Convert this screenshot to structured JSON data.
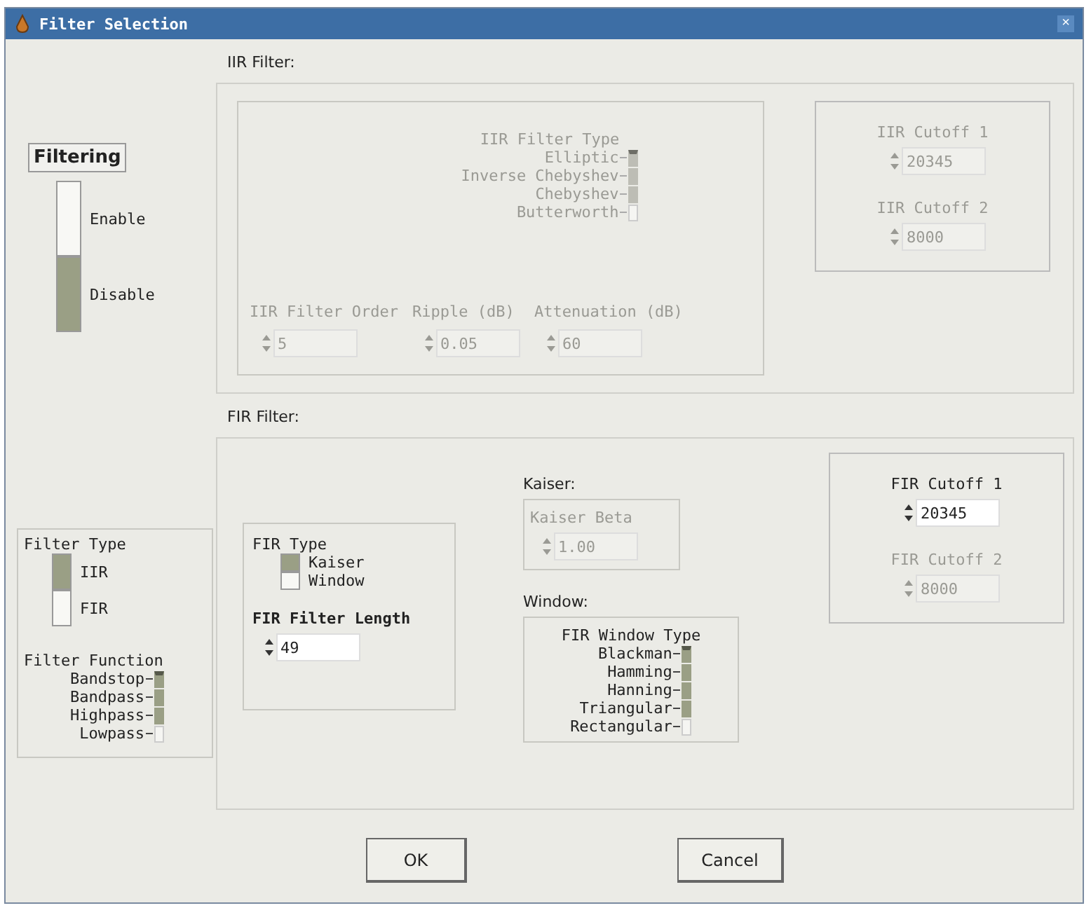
{
  "window": {
    "title": "Filter Selection",
    "close": "×"
  },
  "filtering": {
    "label": "Filtering",
    "options": [
      {
        "label": "Enable",
        "selected": false
      },
      {
        "label": "Disable",
        "selected": true
      }
    ]
  },
  "iir": {
    "heading": "IIR Filter:",
    "disabled": true,
    "type": {
      "label": "IIR Filter Type",
      "options": [
        {
          "label": "Elliptic",
          "selected": true
        },
        {
          "label": "Inverse Chebyshev",
          "selected": false
        },
        {
          "label": "Chebyshev",
          "selected": false
        },
        {
          "label": "Butterworth",
          "selected": false
        }
      ]
    },
    "params": [
      {
        "label": "IIR Filter Order",
        "value": "5"
      },
      {
        "label": "Ripple (dB)",
        "value": "0.05"
      },
      {
        "label": "Attenuation (dB)",
        "value": "60"
      }
    ],
    "cutoffs": [
      {
        "label": "IIR Cutoff 1",
        "value": "20345",
        "disabled": true
      },
      {
        "label": "IIR Cutoff 2",
        "value": "8000",
        "disabled": true
      }
    ]
  },
  "filter_type": {
    "label": "Filter Type",
    "options": [
      {
        "label": "IIR",
        "selected": true
      },
      {
        "label": "FIR",
        "selected": false
      }
    ]
  },
  "filter_function": {
    "label": "Filter Function",
    "options": [
      {
        "label": "Bandstop",
        "selected": true
      },
      {
        "label": "Bandpass",
        "selected": false
      },
      {
        "label": "Highpass",
        "selected": false
      },
      {
        "label": "Lowpass",
        "selected": false
      }
    ]
  },
  "fir": {
    "heading": "FIR Filter:",
    "type": {
      "label": "FIR Type",
      "options": [
        {
          "label": "Kaiser",
          "selected": true
        },
        {
          "label": "Window",
          "selected": false
        }
      ]
    },
    "length": {
      "label": "FIR Filter Length",
      "value": "49"
    },
    "kaiser": {
      "heading": "Kaiser:",
      "label": "Kaiser Beta",
      "value": "1.00",
      "disabled": true
    },
    "window": {
      "heading": "Window:",
      "label": "FIR Window Type",
      "options": [
        {
          "label": "Blackman",
          "selected": true
        },
        {
          "label": "Hamming",
          "selected": false
        },
        {
          "label": "Hanning",
          "selected": false
        },
        {
          "label": "Triangular",
          "selected": false
        },
        {
          "label": "Rectangular",
          "selected": false
        }
      ]
    },
    "cutoffs": [
      {
        "label": "FIR Cutoff 1",
        "value": "20345",
        "disabled": false
      },
      {
        "label": "FIR Cutoff 2",
        "value": "8000",
        "disabled": true
      }
    ]
  },
  "buttons": [
    "OK",
    "Cancel"
  ]
}
